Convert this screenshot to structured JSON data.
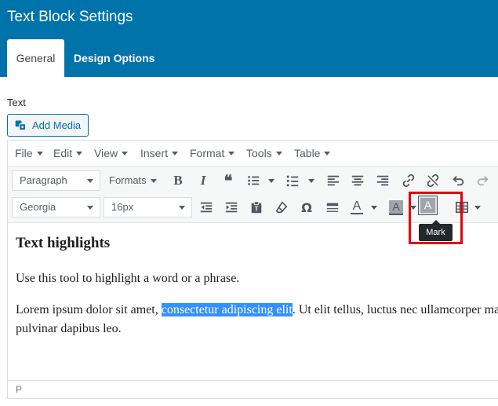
{
  "header": {
    "title": "Text Block Settings",
    "tabs": [
      {
        "label": "General",
        "active": true
      },
      {
        "label": "Design Options",
        "active": false
      }
    ],
    "bg_color": "#0073aa"
  },
  "field": {
    "label": "Text",
    "add_media_label": "Add Media"
  },
  "menubar": {
    "items": [
      "File",
      "Edit",
      "View",
      "Insert",
      "Format",
      "Tools",
      "Table"
    ]
  },
  "toolbar": {
    "block_format": "Paragraph",
    "formats_label": "Formats",
    "font_family": "Georgia",
    "font_size": "16px",
    "row1_icons": [
      "bold-icon",
      "italic-icon",
      "blockquote-icon",
      "bullet-list-icon",
      "numbered-list-icon",
      "align-left-icon",
      "align-center-icon",
      "align-right-icon",
      "link-icon",
      "unlink-icon",
      "undo-icon",
      "redo-icon"
    ],
    "row2_icons": [
      "outdent-icon",
      "indent-icon",
      "paste-text-icon",
      "clear-formatting-icon",
      "special-character-icon",
      "horizontal-line-icon",
      "text-color-icon",
      "background-color-icon",
      "mark-icon",
      "table-icon"
    ],
    "bold_glyph": "B",
    "italic_glyph": "I",
    "quote_glyph": "❝",
    "omega_glyph": "Ω",
    "text_color_glyph": "A",
    "mark_glyph": "A",
    "mark_tooltip": "Mark"
  },
  "content": {
    "heading": "Text highlights",
    "paragraph1": "Use this tool to highlight a word or a phrase.",
    "paragraph2_before": "Lorem ipsum dolor sit amet, ",
    "paragraph2_selected": "consectetur adipiscing elit",
    "paragraph2_after": ". Ut elit tellus, luctus nec ullamcorper mattis,",
    "paragraph2_line2": "pulvinar dapibus leo."
  },
  "statusbar": {
    "path": "P"
  }
}
